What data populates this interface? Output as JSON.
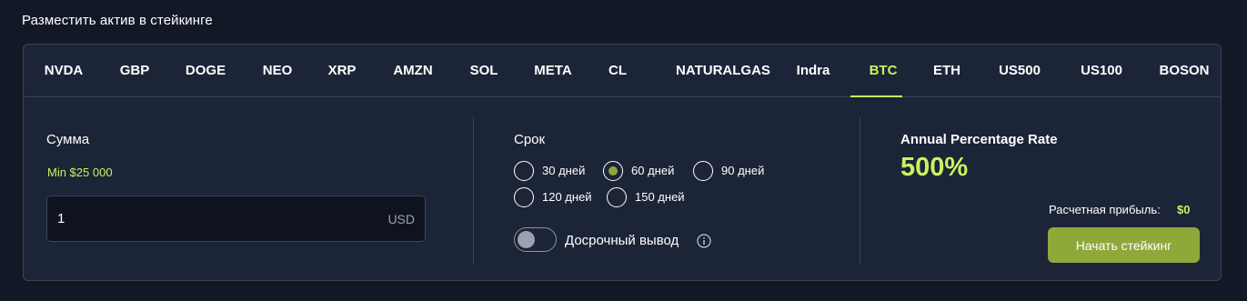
{
  "page": {
    "heading": "Разместить актив в стейкинге"
  },
  "tabs": [
    {
      "label": "NVDA",
      "active": false
    },
    {
      "label": "GBP",
      "active": false
    },
    {
      "label": "DOGE",
      "active": false
    },
    {
      "label": "NEO",
      "active": false
    },
    {
      "label": "XRP",
      "active": false
    },
    {
      "label": "AMZN",
      "active": false
    },
    {
      "label": "SOL",
      "active": false
    },
    {
      "label": "META",
      "active": false
    },
    {
      "label": "CL",
      "active": false
    },
    {
      "label": "NATURALGAS",
      "active": false
    },
    {
      "label": "Indra",
      "active": false
    },
    {
      "label": "BTC",
      "active": true
    },
    {
      "label": "ETH",
      "active": false
    },
    {
      "label": "US500",
      "active": false
    },
    {
      "label": "US100",
      "active": false
    },
    {
      "label": "BOSON",
      "active": false
    }
  ],
  "amount": {
    "label": "Сумма",
    "min_label": "Min $25 000",
    "value": "1",
    "currency": "USD"
  },
  "term": {
    "label": "Срок",
    "options": [
      {
        "label": "30 дней",
        "checked": false
      },
      {
        "label": "60 дней",
        "checked": true
      },
      {
        "label": "90 дней",
        "checked": false
      },
      {
        "label": "120 дней",
        "checked": false
      },
      {
        "label": "150 дней",
        "checked": false
      }
    ],
    "early_withdrawal": {
      "label": "Досрочный вывод",
      "enabled": false
    }
  },
  "apr": {
    "title": "Annual Percentage Rate",
    "value": "500%",
    "profit_label": "Расчетная прибыль:",
    "profit_value": "$0",
    "button_label": "Начать стейкинг"
  },
  "colors": {
    "accent": "#c9f260",
    "button": "#8fa83a",
    "background": "#121826",
    "card": "#1c2437"
  },
  "icons": {
    "info": "info-icon"
  }
}
